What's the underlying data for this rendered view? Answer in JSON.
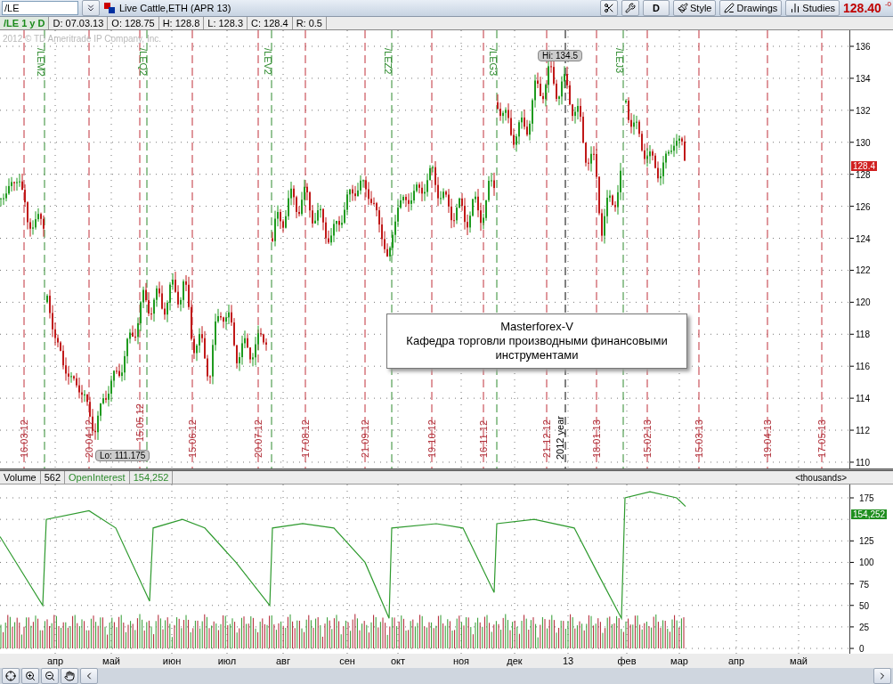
{
  "toolbar": {
    "symbol": "/LE",
    "instrument": "Live Cattle,ETH (APR 13)",
    "period_button": "D",
    "buttons": [
      {
        "label": "Style",
        "kind": "style"
      },
      {
        "label": "Drawings",
        "kind": "drawings"
      },
      {
        "label": "Studies",
        "kind": "studies"
      }
    ],
    "last_price": "128.40",
    "change": "-0"
  },
  "info_bar": {
    "symbol_period": "/LE 1 y D",
    "fields": [
      "D: 07.03.13",
      "O: 128.75",
      "H: 128.8",
      "L: 128.3",
      "C: 128.4",
      "R: 0.5"
    ]
  },
  "price_chart": {
    "copyright": "2012 © TD Ameritrade IP Company, Inc.",
    "y_ticks": [
      "136",
      "134",
      "132",
      "130",
      "128",
      "126",
      "124",
      "122",
      "120",
      "118",
      "116",
      "114",
      "112",
      "110"
    ],
    "date_markers": [
      "16.03.12",
      "20.04.12",
      "15.05.12",
      "15.06.12",
      "20.07.12",
      "17.08.12",
      "21.09.12",
      "19.10.12",
      "16.11.12",
      "21.12.12",
      "18.01.13",
      "15.02.13",
      "15.03.13",
      "19.04.13",
      "17.05.13"
    ],
    "contract_markers": [
      "/LEM2",
      "/LEQ2",
      "/LEV2",
      "/LEZ2",
      "/LEG3",
      "/LEJ3"
    ],
    "year_marker": "2012 year",
    "high_label": "Hi: 134.5",
    "low_label": "Lo: 111.175",
    "last_price_marker": "128.4",
    "note": {
      "title": "Masterforex-V",
      "body": "Кафедра торговли производными финансовыми инструментами"
    }
  },
  "lower_panel": {
    "legend": [
      {
        "text": "Volume"
      },
      {
        "text": "562"
      },
      {
        "text": "OpenInterest",
        "color": "#2e8b2e"
      },
      {
        "text": "154,252",
        "color": "#2e8b2e"
      }
    ],
    "units": "<thousands>",
    "y_ticks": [
      "175",
      "125",
      "100",
      "75",
      "50",
      "25",
      "0"
    ],
    "last_value_marker": "154,252"
  },
  "month_labels": [
    "апр",
    "май",
    "июн",
    "июл",
    "авг",
    "сен",
    "окт",
    "ноя",
    "дек",
    "13",
    "фев",
    "мар",
    "апр",
    "май"
  ]
}
